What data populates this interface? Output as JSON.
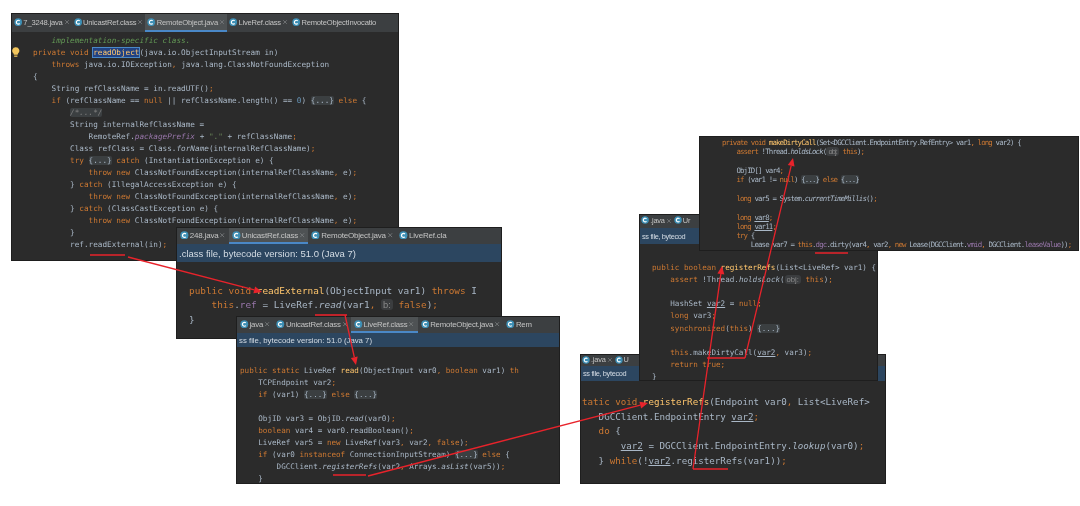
{
  "windows": [
    {
      "bulb": true,
      "tabs": [
        {
          "label": "7_3248.java",
          "selected": false
        },
        {
          "label": "UnicastRef.class",
          "selected": false
        },
        {
          "label": "RemoteObject.java",
          "selected": true
        },
        {
          "label": "LiveRef.class",
          "selected": false
        },
        {
          "label": "RemoteObjectInvocatio",
          "selected": false
        }
      ],
      "lines": [
        {
          "kind": "code",
          "segs": [
            {
              "kind": "doc",
              "text": "    implementation-specific class."
            }
          ]
        },
        {
          "kind": "code",
          "segs": [
            {
              "kind": "kw",
              "text": "private void "
            },
            {
              "kind": "sel",
              "text": "readObject"
            },
            {
              "kind": "plain",
              "text": "(java.io.ObjectInputStream in)"
            }
          ]
        },
        {
          "kind": "code",
          "segs": [
            {
              "kind": "kw",
              "text": "    throws "
            },
            {
              "kind": "plain",
              "text": "java.io.IOException"
            },
            {
              "kind": "kw",
              "text": ", "
            },
            {
              "kind": "plain",
              "text": "java.lang.ClassNotFoundException"
            }
          ]
        },
        {
          "kind": "code",
          "segs": [
            {
              "kind": "plain",
              "text": "{"
            }
          ]
        },
        {
          "kind": "code",
          "segs": [
            {
              "kind": "plain",
              "text": "    String refClassName = in.readUTF()"
            },
            {
              "kind": "kw",
              "text": ";"
            }
          ]
        },
        {
          "kind": "code",
          "segs": [
            {
              "kind": "kw",
              "text": "    if "
            },
            {
              "kind": "plain",
              "text": "(refClassName == "
            },
            {
              "kind": "kw",
              "text": "null"
            },
            {
              "kind": "plain",
              "text": " || refClassName.length() == "
            },
            {
              "kind": "num",
              "text": "0"
            },
            {
              "kind": "plain",
              "text": ") "
            },
            {
              "kind": "fold",
              "text": "{...}"
            },
            {
              "kind": "kw",
              "text": " else "
            },
            {
              "kind": "plain",
              "text": "{"
            }
          ]
        },
        {
          "kind": "code",
          "segs": [
            {
              "kind": "foldc",
              "text": "        /*...*/"
            }
          ]
        },
        {
          "kind": "code",
          "segs": [
            {
              "kind": "plain",
              "text": "        String internalRefClassName ="
            }
          ]
        },
        {
          "kind": "code",
          "segs": [
            {
              "kind": "plain",
              "text": "            RemoteRef."
            },
            {
              "kind": "fieldi",
              "text": "packagePrefix"
            },
            {
              "kind": "plain",
              "text": " + "
            },
            {
              "kind": "str",
              "text": "\".\""
            },
            {
              "kind": "plain",
              "text": " + refClassName"
            },
            {
              "kind": "kw",
              "text": ";"
            }
          ]
        },
        {
          "kind": "code",
          "segs": [
            {
              "kind": "plain",
              "text": "        Class refClass = Class."
            },
            {
              "kind": "call",
              "text": "forName"
            },
            {
              "kind": "plain",
              "text": "(internalRefClassName)"
            },
            {
              "kind": "kw",
              "text": ";"
            }
          ]
        },
        {
          "kind": "code",
          "segs": [
            {
              "kind": "kw",
              "text": "        try "
            },
            {
              "kind": "fold",
              "text": "{...}"
            },
            {
              "kind": "kw",
              "text": " catch "
            },
            {
              "kind": "plain",
              "text": "(InstantiationException e) {"
            }
          ]
        },
        {
          "kind": "code",
          "segs": [
            {
              "kind": "kw",
              "text": "            throw new "
            },
            {
              "kind": "plain",
              "text": "ClassNotFoundException(internalRefClassName"
            },
            {
              "kind": "kw",
              "text": ", "
            },
            {
              "kind": "plain",
              "text": "e)"
            },
            {
              "kind": "kw",
              "text": ";"
            }
          ]
        },
        {
          "kind": "code",
          "segs": [
            {
              "kind": "plain",
              "text": "        } "
            },
            {
              "kind": "kw",
              "text": "catch "
            },
            {
              "kind": "plain",
              "text": "(IllegalAccessException e) {"
            }
          ]
        },
        {
          "kind": "code",
          "segs": [
            {
              "kind": "kw",
              "text": "            throw new "
            },
            {
              "kind": "plain",
              "text": "ClassNotFoundException(internalRefClassName"
            },
            {
              "kind": "kw",
              "text": ", "
            },
            {
              "kind": "plain",
              "text": "e)"
            },
            {
              "kind": "kw",
              "text": ";"
            }
          ]
        },
        {
          "kind": "code",
          "segs": [
            {
              "kind": "plain",
              "text": "        } "
            },
            {
              "kind": "kw",
              "text": "catch "
            },
            {
              "kind": "plain",
              "text": "(ClassCastException e) {"
            }
          ]
        },
        {
          "kind": "code",
          "segs": [
            {
              "kind": "kw",
              "text": "            throw new "
            },
            {
              "kind": "plain",
              "text": "ClassNotFoundException(internalRefClassName"
            },
            {
              "kind": "kw",
              "text": ", "
            },
            {
              "kind": "plain",
              "text": "e)"
            },
            {
              "kind": "kw",
              "text": ";"
            }
          ]
        },
        {
          "kind": "code",
          "segs": [
            {
              "kind": "plain",
              "text": "        }"
            }
          ]
        },
        {
          "kind": "code",
          "segs": [
            {
              "kind": "plain",
              "text": "        ref.readExternal(in)"
            },
            {
              "kind": "kw",
              "text": ";"
            }
          ]
        }
      ]
    },
    {
      "bulb": false,
      "tabs": [
        {
          "label": "248.java",
          "selected": false
        },
        {
          "label": "UnicastRef.class",
          "selected": true
        },
        {
          "label": "RemoteObject.java",
          "selected": false
        },
        {
          "label": "LiveRef.cla",
          "selected": false
        }
      ],
      "banner": ".class file, bytecode version: 51.0 (Java 7)",
      "lines": [
        {
          "kind": "code",
          "segs": [
            {
              "kind": "kw",
              "text": "public void "
            },
            {
              "kind": "decl",
              "text": "readExternal"
            },
            {
              "kind": "plain",
              "text": "(ObjectInput var1) "
            },
            {
              "kind": "kw",
              "text": "throws "
            },
            {
              "kind": "plain",
              "text": "I"
            }
          ]
        },
        {
          "kind": "code",
          "segs": [
            {
              "kind": "kw",
              "text": "    this"
            },
            {
              "kind": "plain",
              "text": "."
            },
            {
              "kind": "field",
              "text": "ref"
            },
            {
              "kind": "plain",
              "text": " = LiveRef."
            },
            {
              "kind": "call",
              "text": "read"
            },
            {
              "kind": "plain",
              "text": "(var1"
            },
            {
              "kind": "kw",
              "text": ", "
            },
            {
              "kind": "hint",
              "text": "b:"
            },
            {
              "kind": "kw",
              "text": " false"
            },
            {
              "kind": "plain",
              "text": ")"
            },
            {
              "kind": "kw",
              "text": ";"
            }
          ]
        },
        {
          "kind": "code",
          "segs": [
            {
              "kind": "plain",
              "text": "}"
            }
          ]
        }
      ]
    },
    {
      "bulb": false,
      "tabs": [
        {
          "label": "java",
          "selected": false
        },
        {
          "label": "UnicastRef.class",
          "selected": false
        },
        {
          "label": "LiveRef.class",
          "selected": true
        },
        {
          "label": "RemoteObject.java",
          "selected": false
        },
        {
          "label": "Rem",
          "selected": false
        }
      ],
      "banner": "ss file, bytecode version: 51.0 (Java 7)",
      "lines": [
        {
          "kind": "code",
          "segs": [
            {
              "kind": "kw",
              "text": "public static "
            },
            {
              "kind": "plain",
              "text": "LiveRef "
            },
            {
              "kind": "decl",
              "text": "read"
            },
            {
              "kind": "plain",
              "text": "(ObjectInput var0"
            },
            {
              "kind": "kw",
              "text": ", boolean "
            },
            {
              "kind": "plain",
              "text": "var1) "
            },
            {
              "kind": "kw",
              "text": "th"
            }
          ]
        },
        {
          "kind": "code",
          "segs": [
            {
              "kind": "plain",
              "text": "    TCPEndpoint var2"
            },
            {
              "kind": "kw",
              "text": ";"
            }
          ]
        },
        {
          "kind": "code",
          "segs": [
            {
              "kind": "kw",
              "text": "    if "
            },
            {
              "kind": "plain",
              "text": "(var1) "
            },
            {
              "kind": "fold",
              "text": "{...}"
            },
            {
              "kind": "kw",
              "text": " else "
            },
            {
              "kind": "fold",
              "text": "{...}"
            }
          ]
        },
        {
          "kind": "blank"
        },
        {
          "kind": "code",
          "segs": [
            {
              "kind": "plain",
              "text": "    ObjID var3 = ObjID."
            },
            {
              "kind": "call",
              "text": "read"
            },
            {
              "kind": "plain",
              "text": "(var0)"
            },
            {
              "kind": "kw",
              "text": ";"
            }
          ]
        },
        {
          "kind": "code",
          "segs": [
            {
              "kind": "kw",
              "text": "    boolean "
            },
            {
              "kind": "plain",
              "text": "var4 = var0.readBoolean()"
            },
            {
              "kind": "kw",
              "text": ";"
            }
          ]
        },
        {
          "kind": "code",
          "segs": [
            {
              "kind": "plain",
              "text": "    LiveRef var5 = "
            },
            {
              "kind": "kw",
              "text": "new "
            },
            {
              "kind": "plain",
              "text": "LiveRef(var3"
            },
            {
              "kind": "kw",
              "text": ", "
            },
            {
              "kind": "plain",
              "text": "var2"
            },
            {
              "kind": "kw",
              "text": ", false"
            },
            {
              "kind": "plain",
              "text": ")"
            },
            {
              "kind": "kw",
              "text": ";"
            }
          ]
        },
        {
          "kind": "code",
          "segs": [
            {
              "kind": "kw",
              "text": "    if "
            },
            {
              "kind": "plain",
              "text": "(var0 "
            },
            {
              "kind": "kw",
              "text": "instanceof "
            },
            {
              "kind": "plain",
              "text": "ConnectionInputStream) "
            },
            {
              "kind": "fold",
              "text": "{...}"
            },
            {
              "kind": "kw",
              "text": " else "
            },
            {
              "kind": "plain",
              "text": "{"
            }
          ]
        },
        {
          "kind": "code",
          "segs": [
            {
              "kind": "plain",
              "text": "        DGCClient."
            },
            {
              "kind": "call",
              "text": "registerRefs"
            },
            {
              "kind": "plain",
              "text": "(var2"
            },
            {
              "kind": "kw",
              "text": ", "
            },
            {
              "kind": "plain",
              "text": "Arrays."
            },
            {
              "kind": "call",
              "text": "asList"
            },
            {
              "kind": "plain",
              "text": "(var5))"
            },
            {
              "kind": "kw",
              "text": ";"
            }
          ]
        },
        {
          "kind": "code",
          "segs": [
            {
              "kind": "plain",
              "text": "    }"
            }
          ]
        }
      ]
    },
    {
      "bulb": false,
      "tabs": [
        {
          "label": ".java",
          "selected": false
        },
        {
          "label": "U",
          "selected": false
        }
      ],
      "banner": "ss file, bytecod",
      "lines": [
        {
          "kind": "code",
          "segs": [
            {
              "kind": "kw",
              "text": "tatic void "
            },
            {
              "kind": "decl",
              "text": "registerRefs"
            },
            {
              "kind": "plain",
              "text": "(Endpoint var0"
            },
            {
              "kind": "kw",
              "text": ", "
            },
            {
              "kind": "plain",
              "text": "List<LiveRef>"
            }
          ]
        },
        {
          "kind": "code",
          "segs": [
            {
              "kind": "plain",
              "text": "   DGCClient.EndpointEntry "
            },
            {
              "kind": "var",
              "text": "var2"
            },
            {
              "kind": "kw",
              "text": ";"
            }
          ]
        },
        {
          "kind": "code",
          "segs": [
            {
              "kind": "kw",
              "text": "   do "
            },
            {
              "kind": "plain",
              "text": "{"
            }
          ]
        },
        {
          "kind": "code",
          "segs": [
            {
              "kind": "var",
              "text": "       var2"
            },
            {
              "kind": "plain",
              "text": " = DGCClient.EndpointEntry."
            },
            {
              "kind": "call",
              "text": "lookup"
            },
            {
              "kind": "plain",
              "text": "(var0)"
            },
            {
              "kind": "kw",
              "text": ";"
            }
          ]
        },
        {
          "kind": "code",
          "segs": [
            {
              "kind": "plain",
              "text": "   } "
            },
            {
              "kind": "kw",
              "text": "while"
            },
            {
              "kind": "plain",
              "text": "(!"
            },
            {
              "kind": "var",
              "text": "var2"
            },
            {
              "kind": "plain",
              "text": ".registerRefs(var1))"
            },
            {
              "kind": "kw",
              "text": ";"
            }
          ]
        }
      ]
    },
    {
      "bulb": false,
      "tabs": [
        {
          "label": ".java",
          "selected": false
        },
        {
          "label": "Ur",
          "selected": false
        }
      ],
      "banner": "ss file, bytecod",
      "lines": [
        {
          "kind": "code",
          "segs": [
            {
              "kind": "kw",
              "text": "public boolean "
            },
            {
              "kind": "decl",
              "text": "registerRefs"
            },
            {
              "kind": "plain",
              "text": "(List<LiveRef> var1) {"
            }
          ]
        },
        {
          "kind": "code",
          "segs": [
            {
              "kind": "kw",
              "text": "    assert "
            },
            {
              "kind": "plain",
              "text": "!Thread."
            },
            {
              "kind": "call",
              "text": "holdsLock"
            },
            {
              "kind": "plain",
              "text": "("
            },
            {
              "kind": "hint",
              "text": "obj:"
            },
            {
              "kind": "kw",
              "text": " this"
            },
            {
              "kind": "plain",
              "text": ")"
            },
            {
              "kind": "kw",
              "text": ";"
            }
          ]
        },
        {
          "kind": "blank"
        },
        {
          "kind": "code",
          "segs": [
            {
              "kind": "plain",
              "text": "    HashSet "
            },
            {
              "kind": "var",
              "text": "var2"
            },
            {
              "kind": "plain",
              "text": " = "
            },
            {
              "kind": "kw",
              "text": "null;"
            }
          ]
        },
        {
          "kind": "code",
          "segs": [
            {
              "kind": "kw",
              "text": "    long "
            },
            {
              "kind": "plain",
              "text": "var3"
            },
            {
              "kind": "kw",
              "text": ";"
            }
          ]
        },
        {
          "kind": "code",
          "segs": [
            {
              "kind": "kw",
              "text": "    synchronized"
            },
            {
              "kind": "plain",
              "text": "("
            },
            {
              "kind": "kw",
              "text": "this"
            },
            {
              "kind": "plain",
              "text": ") "
            },
            {
              "kind": "fold",
              "text": "{...}"
            }
          ]
        },
        {
          "kind": "blank"
        },
        {
          "kind": "code",
          "segs": [
            {
              "kind": "kw",
              "text": "    this"
            },
            {
              "kind": "plain",
              "text": ".makeDirtyCall("
            },
            {
              "kind": "var",
              "text": "var2"
            },
            {
              "kind": "kw",
              "text": ", "
            },
            {
              "kind": "plain",
              "text": "var3)"
            },
            {
              "kind": "kw",
              "text": ";"
            }
          ]
        },
        {
          "kind": "code",
          "segs": [
            {
              "kind": "kw",
              "text": "    return true;"
            }
          ]
        },
        {
          "kind": "code",
          "segs": [
            {
              "kind": "plain",
              "text": "}"
            }
          ]
        }
      ]
    },
    {
      "bulb": false,
      "lines": [
        {
          "kind": "code",
          "segs": [
            {
              "kind": "kw",
              "text": "private void "
            },
            {
              "kind": "decl",
              "text": "makeDirtyCall"
            },
            {
              "kind": "plain",
              "text": "(Set<DGCClient.EndpointEntry.RefEntry> var1"
            },
            {
              "kind": "kw",
              "text": ", long "
            },
            {
              "kind": "plain",
              "text": "var2) {"
            }
          ]
        },
        {
          "kind": "code",
          "segs": [
            {
              "kind": "kw",
              "text": "    assert "
            },
            {
              "kind": "plain",
              "text": "!Thread."
            },
            {
              "kind": "call",
              "text": "holdsLock"
            },
            {
              "kind": "plain",
              "text": "("
            },
            {
              "kind": "hint",
              "text": "obj:"
            },
            {
              "kind": "kw",
              "text": " this"
            },
            {
              "kind": "plain",
              "text": ")"
            },
            {
              "kind": "kw",
              "text": ";"
            }
          ]
        },
        {
          "kind": "blank"
        },
        {
          "kind": "code",
          "segs": [
            {
              "kind": "plain",
              "text": "    ObjID[] var4"
            },
            {
              "kind": "kw",
              "text": ";"
            }
          ]
        },
        {
          "kind": "code",
          "segs": [
            {
              "kind": "kw",
              "text": "    if "
            },
            {
              "kind": "plain",
              "text": "(var1 != "
            },
            {
              "kind": "kw",
              "text": "null"
            },
            {
              "kind": "plain",
              "text": ") "
            },
            {
              "kind": "fold",
              "text": "{...}"
            },
            {
              "kind": "kw",
              "text": " else "
            },
            {
              "kind": "fold",
              "text": "{...}"
            }
          ]
        },
        {
          "kind": "blank"
        },
        {
          "kind": "code",
          "segs": [
            {
              "kind": "kw",
              "text": "    long "
            },
            {
              "kind": "plain",
              "text": "var5 = System."
            },
            {
              "kind": "call",
              "text": "currentTimeMillis"
            },
            {
              "kind": "plain",
              "text": "()"
            },
            {
              "kind": "kw",
              "text": ";"
            }
          ]
        },
        {
          "kind": "blank"
        },
        {
          "kind": "code",
          "segs": [
            {
              "kind": "kw",
              "text": "    long "
            },
            {
              "kind": "var",
              "text": "var8"
            },
            {
              "kind": "kw",
              "text": ";"
            }
          ]
        },
        {
          "kind": "code",
          "segs": [
            {
              "kind": "kw",
              "text": "    long "
            },
            {
              "kind": "var",
              "text": "var11"
            },
            {
              "kind": "kw",
              "text": ";"
            }
          ]
        },
        {
          "kind": "code",
          "segs": [
            {
              "kind": "kw",
              "text": "    try "
            },
            {
              "kind": "plain",
              "text": "{"
            }
          ]
        },
        {
          "kind": "code",
          "segs": [
            {
              "kind": "plain",
              "text": "        Lease var7 = "
            },
            {
              "kind": "kw",
              "text": "this"
            },
            {
              "kind": "plain",
              "text": "."
            },
            {
              "kind": "field",
              "text": "dgc"
            },
            {
              "kind": "plain",
              "text": ".dirty(var4"
            },
            {
              "kind": "kw",
              "text": ", "
            },
            {
              "kind": "plain",
              "text": "var2"
            },
            {
              "kind": "kw",
              "text": ", new "
            },
            {
              "kind": "plain",
              "text": "Lease(DGCClient."
            },
            {
              "kind": "field",
              "text": "vmid"
            },
            {
              "kind": "kw",
              "text": ", "
            },
            {
              "kind": "plain",
              "text": "DGCClient."
            },
            {
              "kind": "field",
              "text": "leaseValue"
            },
            {
              "kind": "plain",
              "text": "))"
            },
            {
              "kind": "kw",
              "text": ";"
            }
          ]
        }
      ]
    }
  ]
}
